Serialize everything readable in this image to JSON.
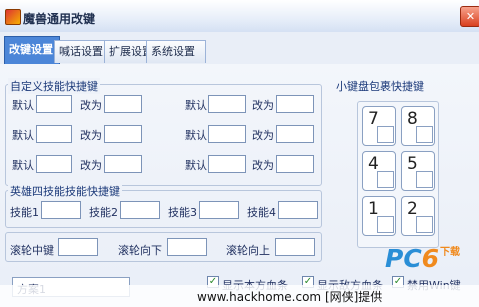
{
  "window": {
    "title": "魔兽通用改键",
    "close_glyph": "✕"
  },
  "tabs": [
    {
      "label": "改键设置",
      "active": true
    },
    {
      "label": "喊话设置",
      "active": false
    },
    {
      "label": "扩展设置",
      "active": false
    },
    {
      "label": "系统设置",
      "active": false
    }
  ],
  "custom_skills": {
    "legend": "自定义技能快捷键",
    "default_label": "默认",
    "change_label": "改为"
  },
  "hero_skills": {
    "legend": "英雄四技能技能快捷键",
    "labels": [
      "技能1",
      "技能2",
      "技能3",
      "技能4"
    ]
  },
  "wheel": {
    "middle": "滚轮中键",
    "down": "滚轮向下",
    "up": "滚轮向上"
  },
  "keypad": {
    "legend": "小键盘包裹快捷键",
    "keys": [
      "7",
      "8",
      "4",
      "5",
      "1",
      "2"
    ]
  },
  "bottom": {
    "combo_value": "方案1",
    "checks": [
      {
        "label": "显示本方血条",
        "checked": true
      },
      {
        "label": "显示敌方血条",
        "checked": true
      },
      {
        "label": "禁用Win键",
        "checked": true
      }
    ]
  },
  "watermark": {
    "logo_pc": "PC",
    "logo_six": "6",
    "sub": "下载"
  },
  "footer": {
    "text": "www.hackhome.com [网侠]提供"
  }
}
